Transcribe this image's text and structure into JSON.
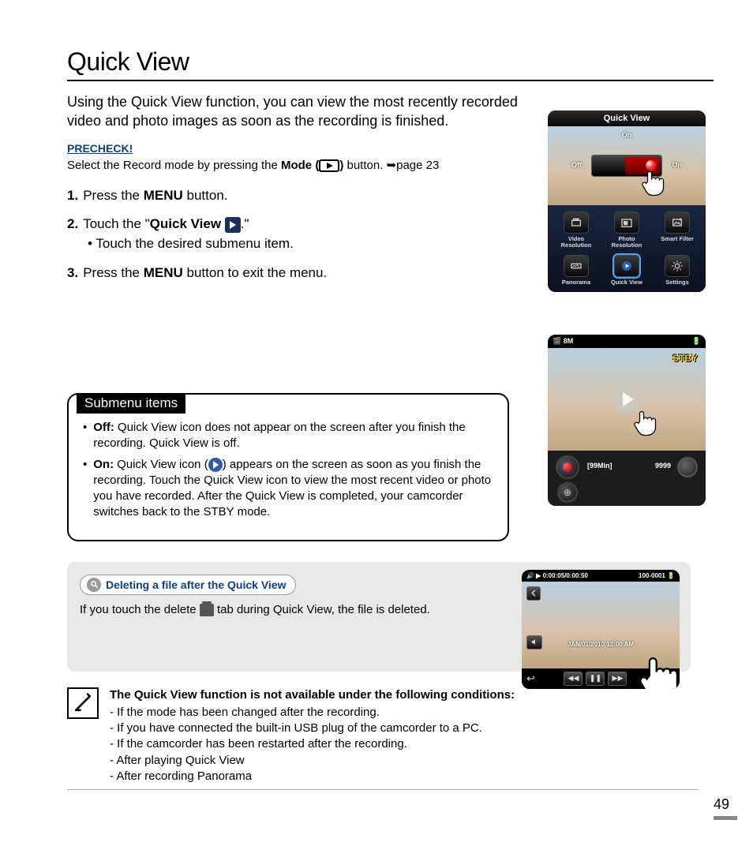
{
  "page": {
    "title": "Quick View",
    "intro": "Using the Quick View function, you can view the most recently recorded video and photo images as soon as the recording is finished.",
    "precheck_label": "PRECHECK!",
    "precheck_text_before": "Select the Record mode by pressing the ",
    "precheck_bold": "Mode (",
    "precheck_after_icon": ")",
    "precheck_text_after": " button. ",
    "precheck_pageref": "➥page 23",
    "page_number": "49"
  },
  "steps": [
    {
      "num": "1.",
      "text_before": "Press the ",
      "bold": "MENU",
      "text_after": " button."
    },
    {
      "num": "2.",
      "text_before": "Touch the \"",
      "bold": "Quick View ",
      "text_after": ".\"",
      "has_icon": true,
      "sub": "•  Touch the desired submenu item."
    },
    {
      "num": "3.",
      "text_before": "Press the ",
      "bold": "MENU",
      "text_after": " button to exit the menu."
    }
  ],
  "submenu": {
    "title": "Submenu items",
    "items": [
      {
        "label": "Off:",
        "desc": "Quick View icon does not appear on the screen after you finish the recording. Quick View is off."
      },
      {
        "label": "On:",
        "desc_before": "Quick View icon (",
        "desc_after": ") appears on the screen as soon as you finish the recording. Touch the Quick View icon to view the most recent video or photo you have recorded. After the Quick View is completed, your camcorder switches back to the STBY mode.",
        "has_icon": true
      }
    ]
  },
  "tip": {
    "pill_label": "Deleting a file after the Quick View",
    "text_before": "If you touch the delete ",
    "text_after": " tab during Quick View, the file is deleted."
  },
  "note": {
    "title": "The Quick View function is not available under the following conditions:",
    "items": [
      "- If the mode has been changed after the recording.",
      "- If you have connected the built-in USB plug of the camcorder to a PC.",
      "- If the camcorder has been restarted after the recording.",
      "- After playing Quick View",
      "- After recording Panorama"
    ]
  },
  "device1": {
    "title": "Quick View",
    "state_label": "On",
    "off_label": "Off",
    "on_label": "On",
    "menu": [
      {
        "label": "Video Resolution"
      },
      {
        "label": "Photo Resolution"
      },
      {
        "label": "Smart Filter"
      },
      {
        "label": "Panorama"
      },
      {
        "label": "Quick View"
      },
      {
        "label": "Settings"
      }
    ]
  },
  "device2": {
    "res": "8M",
    "stby": "STBY",
    "time_remain": "[99Min]",
    "shots_remain": "9999"
  },
  "device3": {
    "time": "0:00:05/0:00:50",
    "file": "100-0001",
    "timestamp": "JAN/01/2010  12:00 AM"
  }
}
